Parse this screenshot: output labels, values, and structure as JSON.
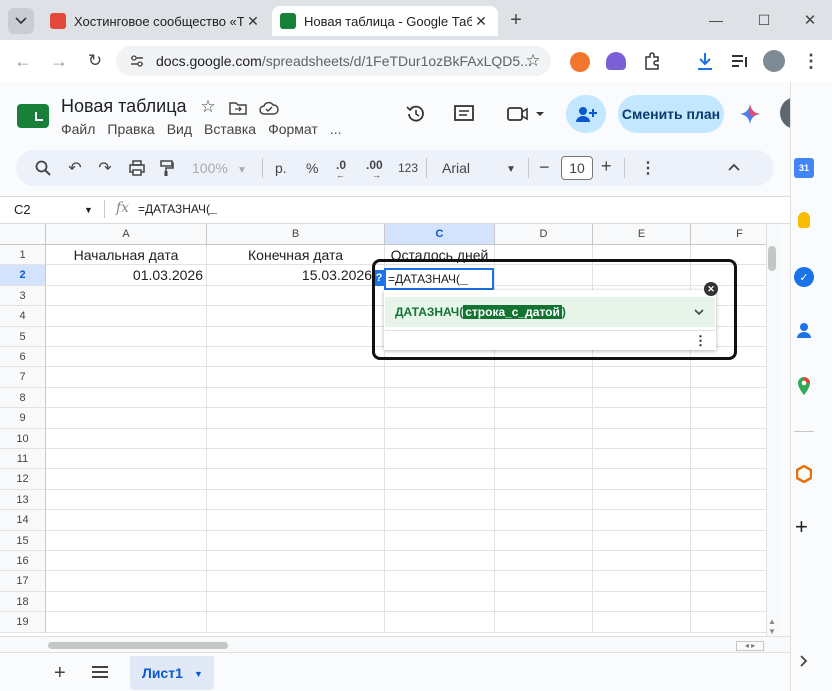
{
  "browser": {
    "tabs": [
      {
        "title": "Хостинговое сообщество «Tim",
        "active": false
      },
      {
        "title": "Новая таблица - Google Табли",
        "active": true
      }
    ],
    "new_tab": "+",
    "url_host": "docs.google.com",
    "url_path": "/spreadsheets/d/1FeTDur1ozBkFAxLQD5..."
  },
  "doc": {
    "title": "Новая таблица",
    "menu": [
      "Файл",
      "Правка",
      "Вид",
      "Вставка",
      "Формат",
      "..."
    ],
    "upgrade_button": "Сменить план"
  },
  "toolbar": {
    "zoom": "100%",
    "currency": "р.",
    "percent": "%",
    "dec_decrease": ".0",
    "dec_increase": ".00",
    "number_format": "123",
    "font": "Arial",
    "font_size": "10"
  },
  "formula_bar": {
    "cell_ref": "C2",
    "fx": "fx",
    "formula": "=ДАТАЗНАЧ("
  },
  "sheet": {
    "columns": [
      "A",
      "B",
      "C",
      "D",
      "E",
      "F"
    ],
    "rows": [
      "1",
      "2",
      "3",
      "4",
      "5",
      "6",
      "7",
      "8",
      "9",
      "10",
      "11",
      "12",
      "13",
      "14",
      "15",
      "16",
      "17",
      "18",
      "19"
    ],
    "cells": {
      "A1": "Начальная дата",
      "B1": "Конечная дата",
      "C1": "Осталось дней",
      "A2": "01.03.2026",
      "B2": "15.03.2026",
      "C2": "=ДАТАЗНАЧ("
    }
  },
  "autocomplete": {
    "help_mark": "?",
    "fn_name": "ДАТАЗНАЧ(",
    "fn_arg": "строка_с_датой",
    "fn_close": ")"
  },
  "sheet_tabs": {
    "add": "+",
    "active_sheet": "Лист1"
  },
  "colors": {
    "accent_green": "#188038",
    "selection_blue": "#1a73e8",
    "upgrade_bg": "#c2e7ff"
  }
}
